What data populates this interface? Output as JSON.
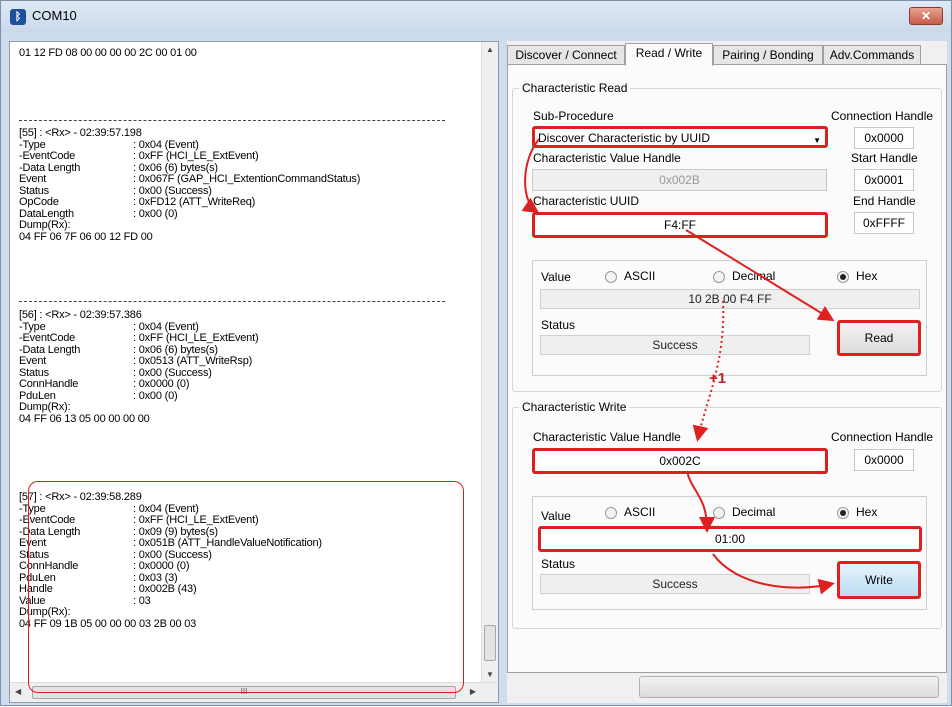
{
  "window": {
    "title": "COM10"
  },
  "log": {
    "top_line": "01 12 FD 08 00 00 00 00 2C 00 01 00",
    "entries": [
      {
        "header": "[55] : <Rx> - 02:39:57.198",
        "rows": [
          [
            "-Type",
            ": 0x04 (Event)"
          ],
          [
            "-EventCode",
            ": 0xFF (HCI_LE_ExtEvent)"
          ],
          [
            "-Data Length",
            ": 0x06 (6) bytes(s)"
          ],
          [
            " Event",
            ": 0x067F (GAP_HCI_ExtentionCommandStatus)"
          ],
          [
            " Status",
            ": 0x00 (Success)"
          ],
          [
            " OpCode",
            ": 0xFD12 (ATT_WriteReq)"
          ],
          [
            " DataLength",
            ": 0x00 (0)"
          ]
        ],
        "dump_label": "Dump(Rx):",
        "dump": "04 FF 06 7F 06 00 12 FD 00"
      },
      {
        "header": "[56] : <Rx> - 02:39:57.386",
        "rows": [
          [
            "-Type",
            ": 0x04 (Event)"
          ],
          [
            "-EventCode",
            ": 0xFF (HCI_LE_ExtEvent)"
          ],
          [
            "-Data Length",
            ": 0x06 (6) bytes(s)"
          ],
          [
            " Event",
            ": 0x0513 (ATT_WriteRsp)"
          ],
          [
            " Status",
            ": 0x00 (Success)"
          ],
          [
            " ConnHandle",
            ": 0x0000 (0)"
          ],
          [
            " PduLen",
            ": 0x00 (0)"
          ]
        ],
        "dump_label": "Dump(Rx):",
        "dump": "04 FF 06 13 05 00 00 00 00"
      },
      {
        "header": "[57] : <Rx> - 02:39:58.289",
        "rows": [
          [
            "-Type",
            ": 0x04 (Event)"
          ],
          [
            "-EventCode",
            ": 0xFF (HCI_LE_ExtEvent)"
          ],
          [
            "-Data Length",
            ": 0x09 (9) bytes(s)"
          ],
          [
            " Event",
            ": 0x051B (ATT_HandleValueNotification)"
          ],
          [
            " Status",
            ": 0x00 (Success)"
          ],
          [
            " ConnHandle",
            ": 0x0000 (0)"
          ],
          [
            " PduLen",
            ": 0x03 (3)"
          ],
          [
            " Handle",
            ": 0x002B (43)"
          ],
          [
            " Value",
            ": 03"
          ]
        ],
        "dump_label": "Dump(Rx):",
        "dump": "04 FF 09 1B 05 00 00 00 03 2B 00 03"
      }
    ],
    "hscroll_grip": "III"
  },
  "tabs": [
    "Discover / Connect",
    "Read / Write",
    "Pairing / Bonding",
    "Adv.Commands"
  ],
  "read": {
    "group_title": "Characteristic Read",
    "sub_procedure_label": "Sub-Procedure",
    "sub_procedure_value": "Discover Characteristic by UUID",
    "conn_handle_label": "Connection Handle",
    "conn_handle_value": "0x0000",
    "char_value_handle_label": "Characteristic Value Handle",
    "char_value_handle_value": "0x002B",
    "start_handle_label": "Start Handle",
    "start_handle_value": "0x0001",
    "char_uuid_label": "Characteristic UUID",
    "char_uuid_value": "F4:FF",
    "end_handle_label": "End Handle",
    "end_handle_value": "0xFFFF",
    "value_label": "Value",
    "radio_ascii": "ASCII",
    "radio_decimal": "Decimal",
    "radio_hex": "Hex",
    "value": "10 2B 00 F4 FF",
    "status_label": "Status",
    "status_value": "Success",
    "button": "Read"
  },
  "write": {
    "group_title": "Characteristic Write",
    "char_value_handle_label": "Characteristic Value Handle",
    "char_value_handle_value": "0x002C",
    "conn_handle_label": "Connection Handle",
    "conn_handle_value": "0x0000",
    "value_label": "Value",
    "radio_ascii": "ASCII",
    "radio_decimal": "Decimal",
    "radio_hex": "Hex",
    "value": "01:00",
    "status_label": "Status",
    "status_value": "Success",
    "button": "Write"
  },
  "annotation": {
    "plus_one": "+1"
  },
  "colors": {
    "annotation_red": "#e02020",
    "selected_tab_bg": "#fbfbfb",
    "write_button_blue": "#bcdcf3"
  }
}
